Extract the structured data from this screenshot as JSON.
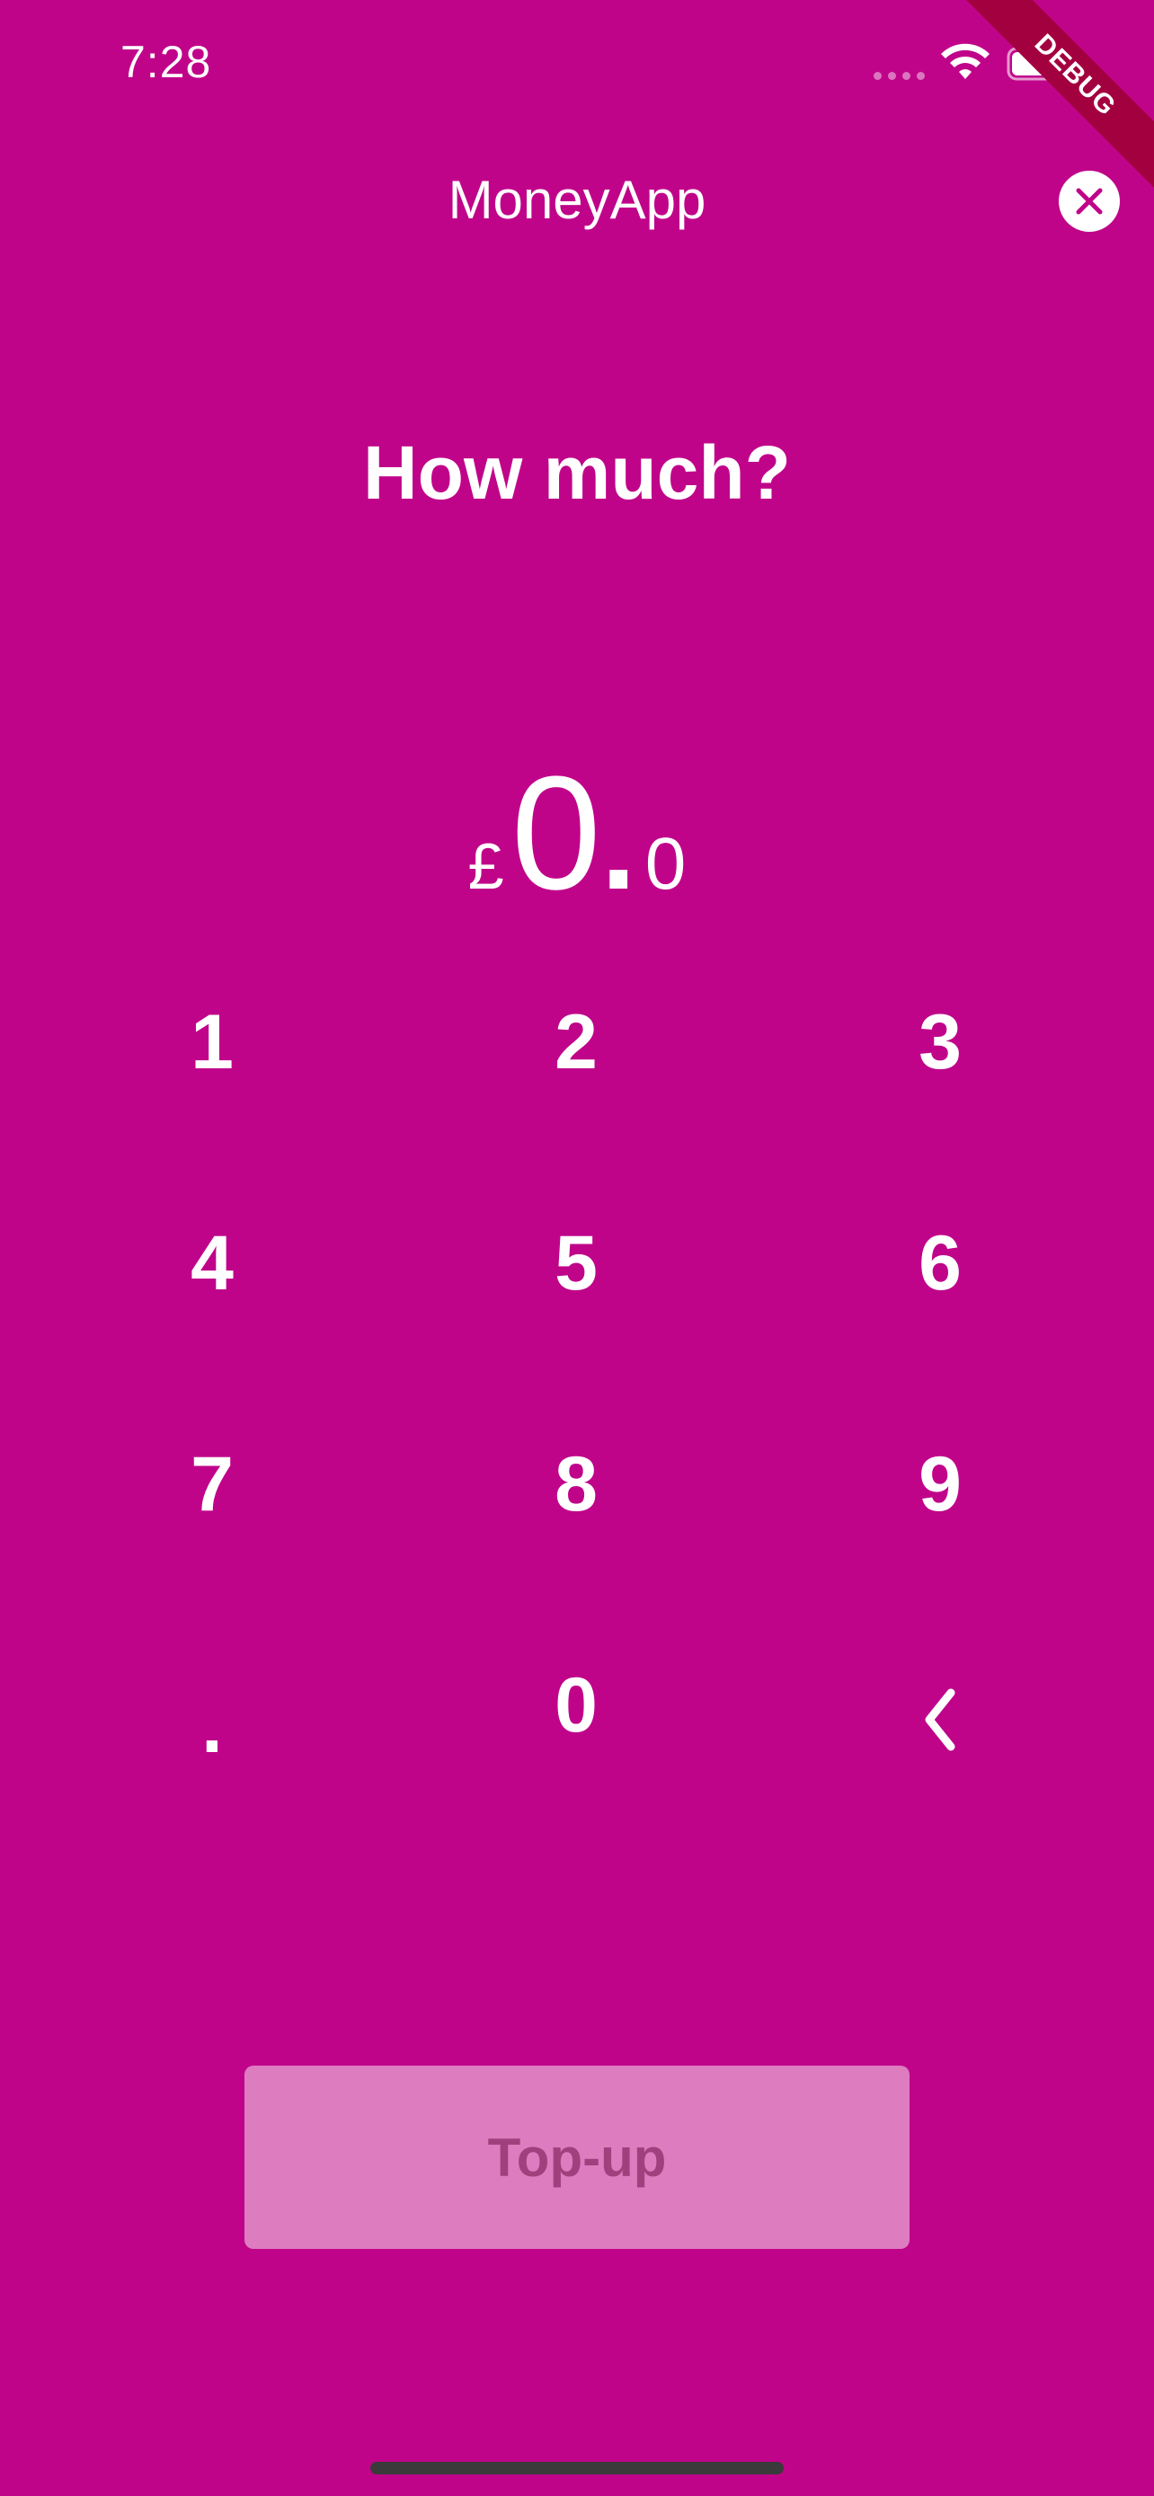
{
  "status_bar": {
    "time": "7:28"
  },
  "debug_banner": {
    "label": "DEBUG"
  },
  "header": {
    "title": "MoneyApp",
    "close_icon": "close-circle-icon"
  },
  "headline": "How much?",
  "amount": {
    "currency": "£",
    "integer": "0",
    "separator": ".",
    "decimal": "0"
  },
  "keypad": {
    "keys": [
      "1",
      "2",
      "3",
      "4",
      "5",
      "6",
      "7",
      "8",
      "9",
      ".",
      "0"
    ],
    "backspace_icon": "chevron-left-icon"
  },
  "actions": {
    "topup_label": "Top-up"
  },
  "colors": {
    "background": "#c0048a",
    "button_disabled": "#dd7cbf",
    "button_text_disabled": "#a0417e"
  }
}
